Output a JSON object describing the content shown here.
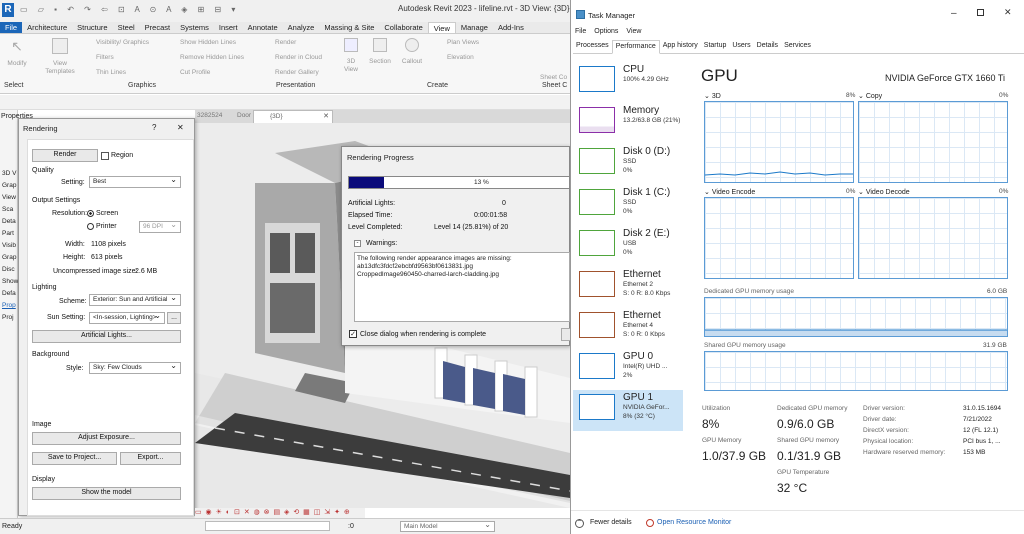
{
  "revit": {
    "title": "Autodesk Revit 2023 - lifeline.rvt - 3D View: {3D}",
    "tabs": [
      "File",
      "Architecture",
      "Structure",
      "Steel",
      "Precast",
      "Systems",
      "Insert",
      "Annotate",
      "Analyze",
      "Massing & Site",
      "Collaborate",
      "View",
      "Manage",
      "Add-Ins"
    ],
    "active_tab": "View",
    "ribbon": {
      "modify": "Modify",
      "view_templates": "View Templates",
      "visibility_graphics": "Visibility/ Graphics",
      "filters": "Filters",
      "thin_lines": "Thin Lines",
      "show_hidden_lines": "Show Hidden Lines",
      "remove_hidden_lines": "Remove Hidden Lines",
      "cut_profile": "Cut Profile",
      "render": "Render",
      "render_in_cloud": "Render in Cloud",
      "render_gallery": "Render Gallery",
      "view_3d": "3D View",
      "section": "Section",
      "callout": "Callout",
      "plan_views": "Plan Views",
      "elevation": "Elevation",
      "sheet_collection": "Sheet Co",
      "group_select": "Select",
      "group_graphics": "Graphics",
      "group_presentation": "Presentation",
      "group_create": "Create",
      "group_sheet": "Sheet C"
    },
    "properties_label": "Properties",
    "doc_tabs": [
      "3282524",
      "Door Schedule",
      "{3D}"
    ],
    "left_panel_items": [
      "3D V",
      "Grap",
      "View",
      "Sca",
      "Deta",
      "Part",
      "Visib",
      "Grap",
      "Disc",
      "Show",
      "Defa",
      "Prop",
      "Proj"
    ],
    "status_ready": "Ready",
    "status_scale": ":0",
    "status_model": "Main Model"
  },
  "rendering_dialog": {
    "title": "Rendering",
    "help": "?",
    "close": "✕",
    "render_button": "Render",
    "region_label": "Region",
    "quality_label": "Quality",
    "setting_label": "Setting:",
    "setting_value": "Best",
    "output_settings": "Output Settings",
    "resolution_label": "Resolution:",
    "screen": "Screen",
    "printer": "Printer",
    "dpi_value": "96 DPI",
    "width_label": "Width:",
    "width_value": "1108 pixels",
    "height_label": "Height:",
    "height_value": "613 pixels",
    "uncompressed_label": "Uncompressed image size:",
    "uncompressed_value": "2.6 MB",
    "lighting": "Lighting",
    "scheme_label": "Scheme:",
    "scheme_value": "Exterior: Sun and Artificial",
    "sun_label": "Sun Setting:",
    "sun_value": "<In-session, Lighting>",
    "sun_browse": "...",
    "artificial_lights": "Artificial Lights...",
    "background": "Background",
    "style_label": "Style:",
    "style_value": "Sky: Few Clouds",
    "image": "Image",
    "adjust_exposure": "Adjust Exposure...",
    "save_to_project": "Save to Project...",
    "export": "Export...",
    "display": "Display",
    "show_model": "Show the model"
  },
  "progress_dialog": {
    "title": "Rendering Progress",
    "percent_text": "13 %",
    "percent_value": 13,
    "artificial_lights_label": "Artificial Lights:",
    "artificial_lights_value": "0",
    "elapsed_label": "Elapsed Time:",
    "elapsed_value": "0:00:01:58",
    "level_label": "Level Completed:",
    "level_value": "Level 14 (25.81%) of 20",
    "warnings_label": "Warnings:",
    "warnings_toggle": "-",
    "warning_lines": [
      "The following render appearance images are missing:",
      "ab13dfc3fdcf2ebcbfd9563bf0613831.jpg",
      "CroppedImage960450-charred-larch-cladding.jpg"
    ],
    "close_checkbox": "Close dialog when rendering is complete"
  },
  "task_manager": {
    "title": "Task Manager",
    "menu": [
      "File",
      "Options",
      "View"
    ],
    "tabs": [
      "Processes",
      "Performance",
      "App history",
      "Startup",
      "Users",
      "Details",
      "Services"
    ],
    "active_tab": "Performance",
    "sidebar": [
      {
        "name": "CPU",
        "l1": "100%  4.29 GHz",
        "l2": "",
        "color": "#1b79c9"
      },
      {
        "name": "Memory",
        "l1": "13.2/63.8 GB (21%)",
        "l2": "",
        "color": "#8b2fa8"
      },
      {
        "name": "Disk 0 (D:)",
        "l1": "SSD",
        "l2": "0%",
        "color": "#4fa53c"
      },
      {
        "name": "Disk 1 (C:)",
        "l1": "SSD",
        "l2": "0%",
        "color": "#4fa53c"
      },
      {
        "name": "Disk 2 (E:)",
        "l1": "USB",
        "l2": "0%",
        "color": "#4fa53c"
      },
      {
        "name": "Ethernet",
        "l1": "Ethernet 2",
        "l2": "S: 0  R: 8.0 Kbps",
        "color": "#a0522d"
      },
      {
        "name": "Ethernet",
        "l1": "Ethernet 4",
        "l2": "S: 0  R: 0 Kbps",
        "color": "#a0522d"
      },
      {
        "name": "GPU 0",
        "l1": "Intel(R) UHD ...",
        "l2": "2%",
        "color": "#1b79c9"
      },
      {
        "name": "GPU 1",
        "l1": "NVIDIA GeFor...",
        "l2": "8% (32 °C)",
        "color": "#1b79c9"
      }
    ],
    "selected_index": 8,
    "gpu_heading": "GPU",
    "gpu_name": "NVIDIA GeForce GTX 1660 Ti",
    "graphs": [
      {
        "label": "3D",
        "pct": "8%"
      },
      {
        "label": "Copy",
        "pct": "0%"
      },
      {
        "label": "Video Encode",
        "pct": "0%"
      },
      {
        "label": "Video Decode",
        "pct": "0%"
      }
    ],
    "dedicated_label": "Dedicated GPU memory usage",
    "dedicated_max": "6.0 GB",
    "shared_label": "Shared GPU memory usage",
    "shared_max": "31.9 GB",
    "stats": {
      "utilization_label": "Utilization",
      "utilization_value": "8%",
      "dedicated_label": "Dedicated GPU memory",
      "dedicated_value": "0.9/6.0 GB",
      "gpu_memory_label": "GPU Memory",
      "gpu_memory_value": "1.0/37.9 GB",
      "shared_label": "Shared GPU memory",
      "shared_value": "0.1/31.9 GB",
      "temp_label": "GPU Temperature",
      "temp_value": "32 °C"
    },
    "info": [
      {
        "k": "Driver version:",
        "v": "31.0.15.1694"
      },
      {
        "k": "Driver date:",
        "v": "7/21/2022"
      },
      {
        "k": "DirectX version:",
        "v": "12 (FL 12.1)"
      },
      {
        "k": "Physical location:",
        "v": "PCI bus 1, ..."
      },
      {
        "k": "Hardware reserved memory:",
        "v": "153 MB"
      }
    ],
    "fewer_details": "Fewer details",
    "open_resource_monitor": "Open Resource Monitor"
  }
}
